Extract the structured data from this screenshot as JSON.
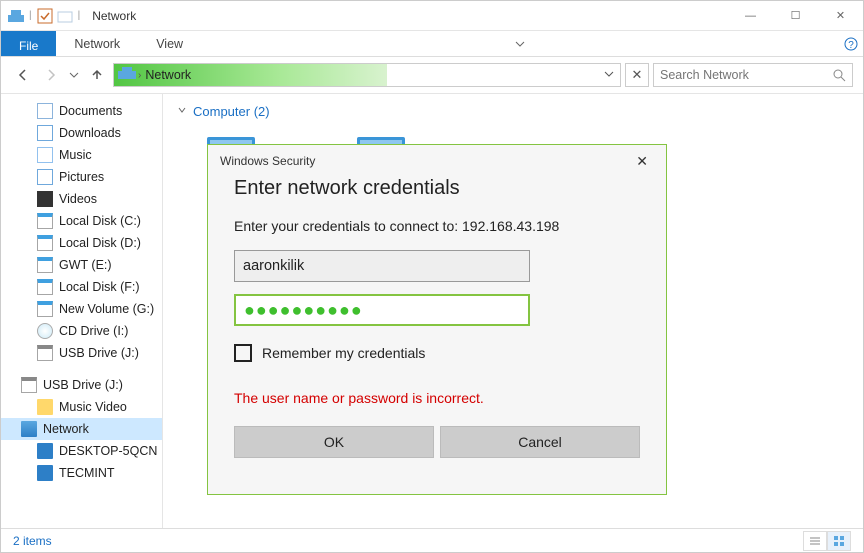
{
  "window": {
    "title": "Network"
  },
  "ribbon": {
    "file": "File",
    "tabs": [
      "Network",
      "View"
    ]
  },
  "address": {
    "text": "Network"
  },
  "search": {
    "placeholder": "Search Network"
  },
  "tree": [
    {
      "label": "Documents",
      "icon": "doc",
      "lvl": 2
    },
    {
      "label": "Downloads",
      "icon": "down",
      "lvl": 2
    },
    {
      "label": "Music",
      "icon": "music",
      "lvl": 2
    },
    {
      "label": "Pictures",
      "icon": "pic",
      "lvl": 2
    },
    {
      "label": "Videos",
      "icon": "vid",
      "lvl": 2
    },
    {
      "label": "Local Disk (C:)",
      "icon": "disk",
      "lvl": 2
    },
    {
      "label": "Local Disk (D:)",
      "icon": "disk",
      "lvl": 2
    },
    {
      "label": "GWT (E:)",
      "icon": "disk",
      "lvl": 2
    },
    {
      "label": "Local Disk (F:)",
      "icon": "disk",
      "lvl": 2
    },
    {
      "label": "New Volume (G:)",
      "icon": "disk",
      "lvl": 2
    },
    {
      "label": "CD Drive (I:)",
      "icon": "cd",
      "lvl": 2
    },
    {
      "label": "USB Drive (J:)",
      "icon": "usb",
      "lvl": 2
    },
    {
      "label": "",
      "spacer": true
    },
    {
      "label": "USB Drive (J:)",
      "icon": "usb",
      "lvl": 1
    },
    {
      "label": "Music Video",
      "icon": "folder",
      "lvl": 2
    },
    {
      "label": "Network",
      "icon": "net",
      "lvl": 1,
      "sel": true
    },
    {
      "label": "DESKTOP-5QCN",
      "icon": "comp",
      "lvl": 2
    },
    {
      "label": "TECMINT",
      "icon": "comp",
      "lvl": 2
    }
  ],
  "content": {
    "group": "Computer (2)"
  },
  "status": {
    "text": "2 items"
  },
  "dialog": {
    "title": "Windows Security",
    "heading": "Enter network credentials",
    "instruction": "Enter your credentials to connect to: 192.168.43.198",
    "username": "aaronkilik",
    "password_mask": "●●●●●●●●●●",
    "remember": "Remember my credentials",
    "error": "The user name or password is incorrect.",
    "ok": "OK",
    "cancel": "Cancel"
  }
}
